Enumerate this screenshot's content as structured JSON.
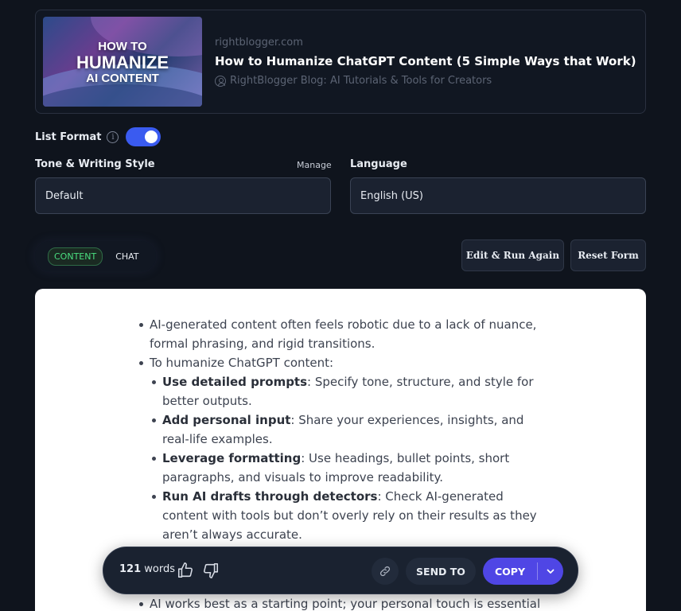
{
  "preview": {
    "thumbnail_text": [
      "HOW TO",
      "HUMANIZE",
      "AI CONTENT"
    ],
    "domain": "rightblogger.com",
    "title": "How to Humanize ChatGPT Content (5 Simple Ways that Work)",
    "source": "RightBlogger Blog: AI Tutorials & Tools for Creators"
  },
  "list_format": {
    "label": "List Format",
    "enabled": true
  },
  "tone": {
    "label": "Tone & Writing Style",
    "manage_label": "Manage",
    "value": "Default"
  },
  "language": {
    "label": "Language",
    "value": "English (US)"
  },
  "tabs": {
    "content": "CONTENT",
    "chat": "CHAT"
  },
  "buttons": {
    "edit_run": "Edit & Run Again",
    "reset": "Reset Form"
  },
  "output": {
    "items": [
      {
        "text": "AI-generated content often feels robotic due to a lack of nuance, formal phrasing, and rigid transitions."
      },
      {
        "text": "To humanize ChatGPT content:"
      }
    ],
    "subitems": [
      {
        "bold": "Use detailed prompts",
        "text": ": Specify tone, structure, and style for better outputs."
      },
      {
        "bold": "Add personal input",
        "text": ": Share your experiences, insights, and real-life examples."
      },
      {
        "bold": "Leverage formatting",
        "text": ": Use headings, bullet points, short paragraphs, and visuals to improve readability."
      },
      {
        "bold": "Run AI drafts through detectors",
        "text": ": Check AI-generated content with tools but don’t overly rely on their results as they aren’t always accurate."
      }
    ],
    "last_item": "AI works best as a starting point; your personal touch is essential to"
  },
  "actionbar": {
    "word_count": "121",
    "words_label": "words",
    "send_to": "SEND TO",
    "copy": "COPY"
  },
  "colors": {
    "accent": "#4f46e5",
    "toggle": "#3a5bf0",
    "content_tab": "#4ade80"
  }
}
